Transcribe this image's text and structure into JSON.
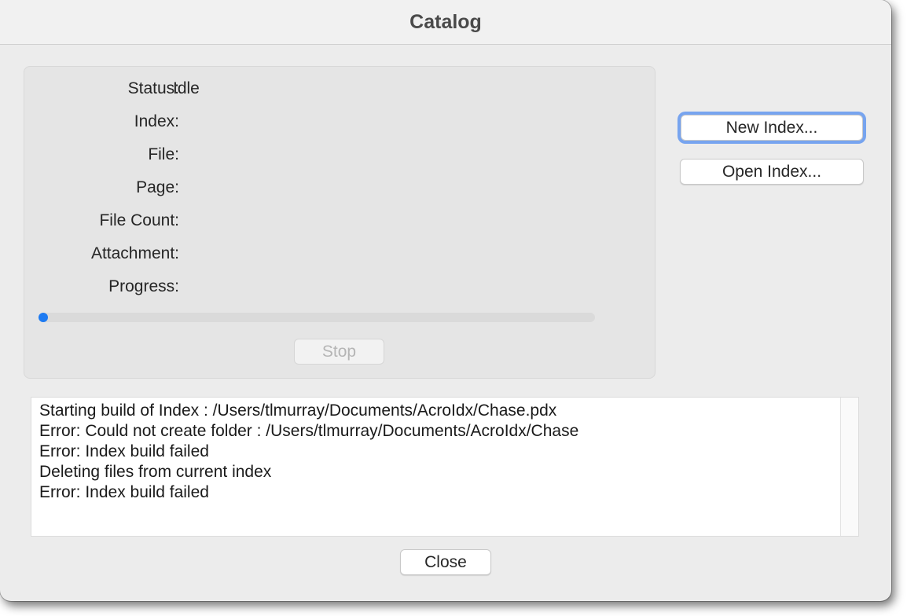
{
  "window": {
    "title": "Catalog"
  },
  "status": {
    "rows": [
      {
        "label": "Status:",
        "value": "Idle"
      },
      {
        "label": "Index:",
        "value": ""
      },
      {
        "label": "File:",
        "value": ""
      },
      {
        "label": "Page:",
        "value": ""
      },
      {
        "label": "File Count:",
        "value": ""
      },
      {
        "label": "Attachment:",
        "value": ""
      },
      {
        "label": "Progress:",
        "value": ""
      }
    ],
    "progress_fraction": 0,
    "progress_color": "#1e7bf2",
    "stop_label": "Stop"
  },
  "actions": {
    "new_index_label": "New Index...",
    "open_index_label": "Open Index..."
  },
  "log": {
    "lines": [
      "Starting build of Index : /Users/tlmurray/Documents/AcroIdx/Chase.pdx",
      "Error: Could not create folder : /Users/tlmurray/Documents/AcroIdx/Chase",
      "Error: Index build failed",
      "Deleting files from current index",
      "Error: Index build failed"
    ]
  },
  "footer": {
    "close_label": "Close"
  }
}
